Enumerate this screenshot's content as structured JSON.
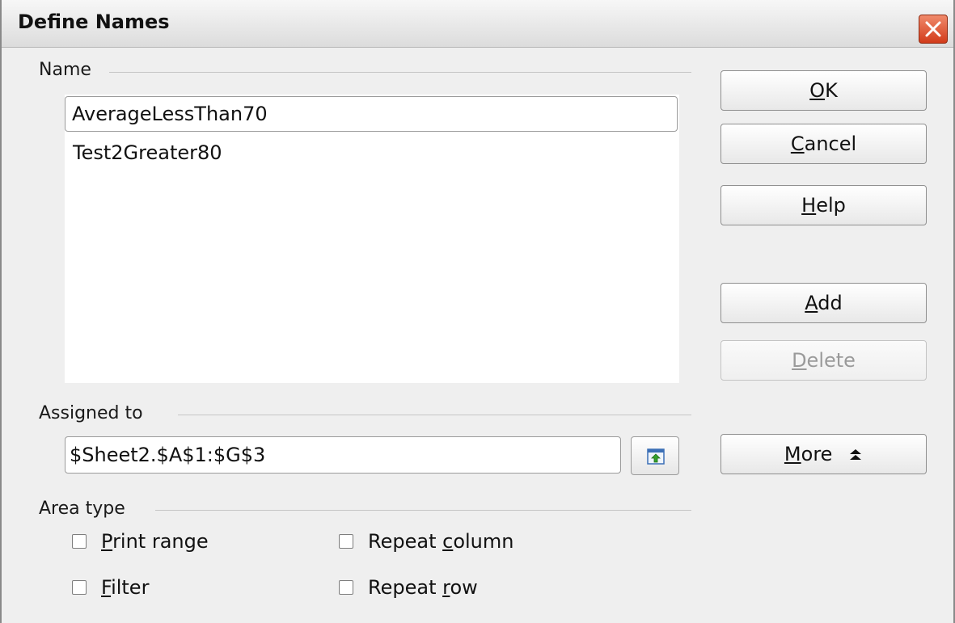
{
  "window": {
    "title": "Define Names"
  },
  "name_group": {
    "label": "Name",
    "input_value": "AverageLessThan70",
    "list_items": [
      "Test2Greater80"
    ]
  },
  "buttons": {
    "ok": {
      "mnemonic": "O",
      "rest": "K"
    },
    "cancel": {
      "mnemonic": "C",
      "rest": "ancel"
    },
    "help": {
      "mnemonic": "H",
      "rest": "elp"
    },
    "add": {
      "mnemonic": "A",
      "rest": "dd"
    },
    "delete": {
      "mnemonic": "D",
      "rest": "elete"
    },
    "more": {
      "mnemonic": "M",
      "rest": "ore",
      "arrow": "⯭"
    }
  },
  "assigned_group": {
    "label": "Assigned to",
    "value": "$Sheet2.$A$1:$G$3"
  },
  "area_type_group": {
    "label": "Area type",
    "print_range": {
      "mnemonic": "P",
      "rest": "rint range"
    },
    "filter": {
      "mnemonic": "F",
      "rest": "ilter"
    },
    "repeat_column": {
      "before": "Repeat ",
      "mnemonic": "c",
      "rest": "olumn"
    },
    "repeat_row": {
      "before": "Repeat ",
      "mnemonic": "r",
      "rest": "ow"
    }
  },
  "colors": {
    "close_button": "#d23b1a",
    "background": "#efefef"
  }
}
